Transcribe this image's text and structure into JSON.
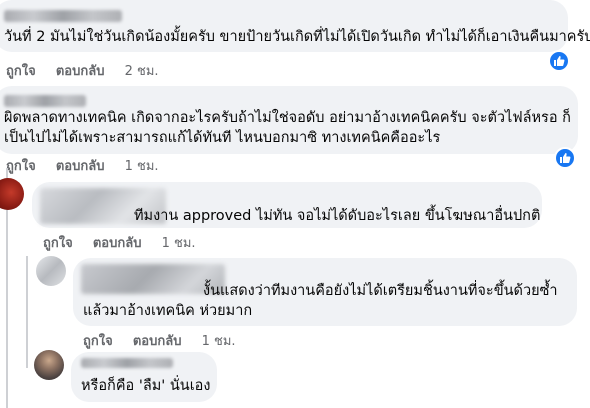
{
  "comments": [
    {
      "text_lines": [
        "วันที่ 2 มันไม่ใช่วันเกิดน้องมั้ยครับ ขายป้ายวันเกิดที่ไม่ได้เปิดวันเกิด ทำไม่ได้ก็เอาเงินคืนมาครับ"
      ],
      "like_label": "ถูกใจ",
      "reply_label": "ตอบกลับ",
      "time": "2 ชม.",
      "has_like_reaction": true
    },
    {
      "text_lines": [
        "ผิดพลาดทางเทคนิค เกิดจากอะไรครับถ้าไม่ใช่จอดับ อย่ามาอ้างเทคนิคครับ จะตัวไฟล์หรอ ก็",
        "เป็นไปไม่ได้เพราะสามารถแก้ได้ทันที ไหนบอกมาซิ ทางเทคนิคคืออะไร"
      ],
      "like_label": "ถูกใจ",
      "reply_label": "ตอบกลับ",
      "time": "1 ชม.",
      "has_like_reaction": true
    },
    {
      "text_lines": [
        "ทีมงาน approved ไม่ทัน จอไม่ได้ดับอะไรเลย ขึ้นโฆษณาอื่นปกติ"
      ],
      "like_label": "ถูกใจ",
      "reply_label": "ตอบกลับ",
      "time": "1 ชม.",
      "has_like_reaction": false
    },
    {
      "text_lines": [
        "งั้นแสดงว่าทีมงานคือยังไม่ได้เตรียมชิ้นงานที่จะขึ้นด้วยซ้ำ",
        "แล้วมาอ้างเทคนิค ห่วยมาก"
      ],
      "like_label": "ถูกใจ",
      "reply_label": "ตอบกลับ",
      "time": "1 ชม.",
      "has_like_reaction": false
    },
    {
      "text_lines": [
        "หรือก็คือ 'ลืม' นั่นเอง"
      ],
      "has_like_reaction": false
    }
  ],
  "colors": {
    "bubble": "#f0f2f5",
    "meta_text": "#65676b",
    "like_blue": "#1877f2",
    "thread_line": "#ced0d4"
  },
  "icons": {
    "reaction": "thumbs-up-icon"
  }
}
